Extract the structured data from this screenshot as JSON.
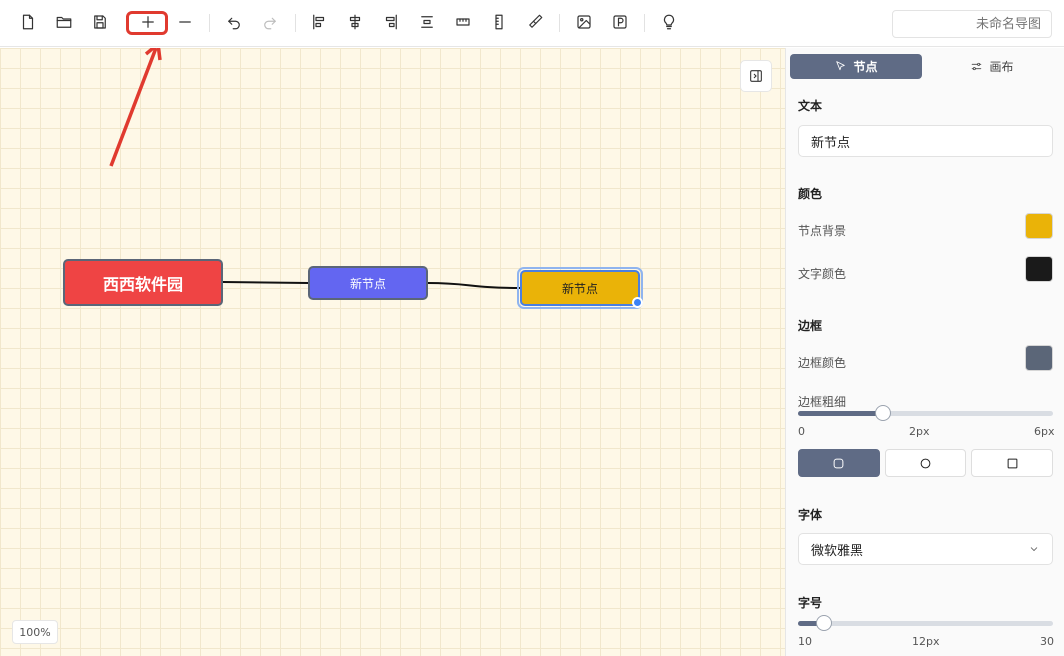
{
  "toolbar": {
    "title_placeholder": "未命名导图",
    "icons": [
      "new-file-icon",
      "open-folder-icon",
      "save-icon",
      "plus-icon",
      "minus-icon",
      "undo-icon",
      "redo-icon",
      "align-left-icon",
      "align-center-icon",
      "align-right-icon",
      "distribute-vertical-icon",
      "distribute-horizontal-icon",
      "ruler-icon",
      "brush-icon",
      "image-icon",
      "export-p-icon",
      "lightbulb-icon"
    ],
    "highlight_color": "#e03a2f"
  },
  "canvas": {
    "zoom": "100%",
    "nodes": [
      {
        "text": "西西软件园",
        "color": "#ef4444"
      },
      {
        "text": "新节点",
        "color": "#6366f1"
      },
      {
        "text": "新节点",
        "color": "#eab308",
        "selected": true
      }
    ]
  },
  "panel": {
    "tabs": [
      {
        "label": "节点",
        "icon": "cursor-icon",
        "active": true
      },
      {
        "label": "画布",
        "icon": "sliders-icon",
        "active": false
      }
    ],
    "text_section": "文本",
    "text_value": "新节点",
    "color_section": "颜色",
    "node_bg_label": "节点背景",
    "node_bg_color": "#eab308",
    "text_color_label": "文字颜色",
    "text_color": "#1a1a1a",
    "border_section": "边框",
    "border_color_label": "边框颜色",
    "border_color": "#5b6678",
    "border_width_label": "边框粗细",
    "border_width": {
      "min": "0",
      "value_label": "2px",
      "max": "6px",
      "value": 2,
      "range_max": 6
    },
    "shapes": [
      {
        "name": "rounded-rect-icon",
        "active": true
      },
      {
        "name": "circle-icon",
        "active": false
      },
      {
        "name": "square-icon",
        "active": false
      }
    ],
    "font_section": "字体",
    "font_value": "微软雅黑",
    "size_section": "字号",
    "font_size": {
      "min": "10",
      "value_label": "12px",
      "max": "30",
      "value": 12,
      "range_min": 10,
      "range_max": 30
    }
  }
}
